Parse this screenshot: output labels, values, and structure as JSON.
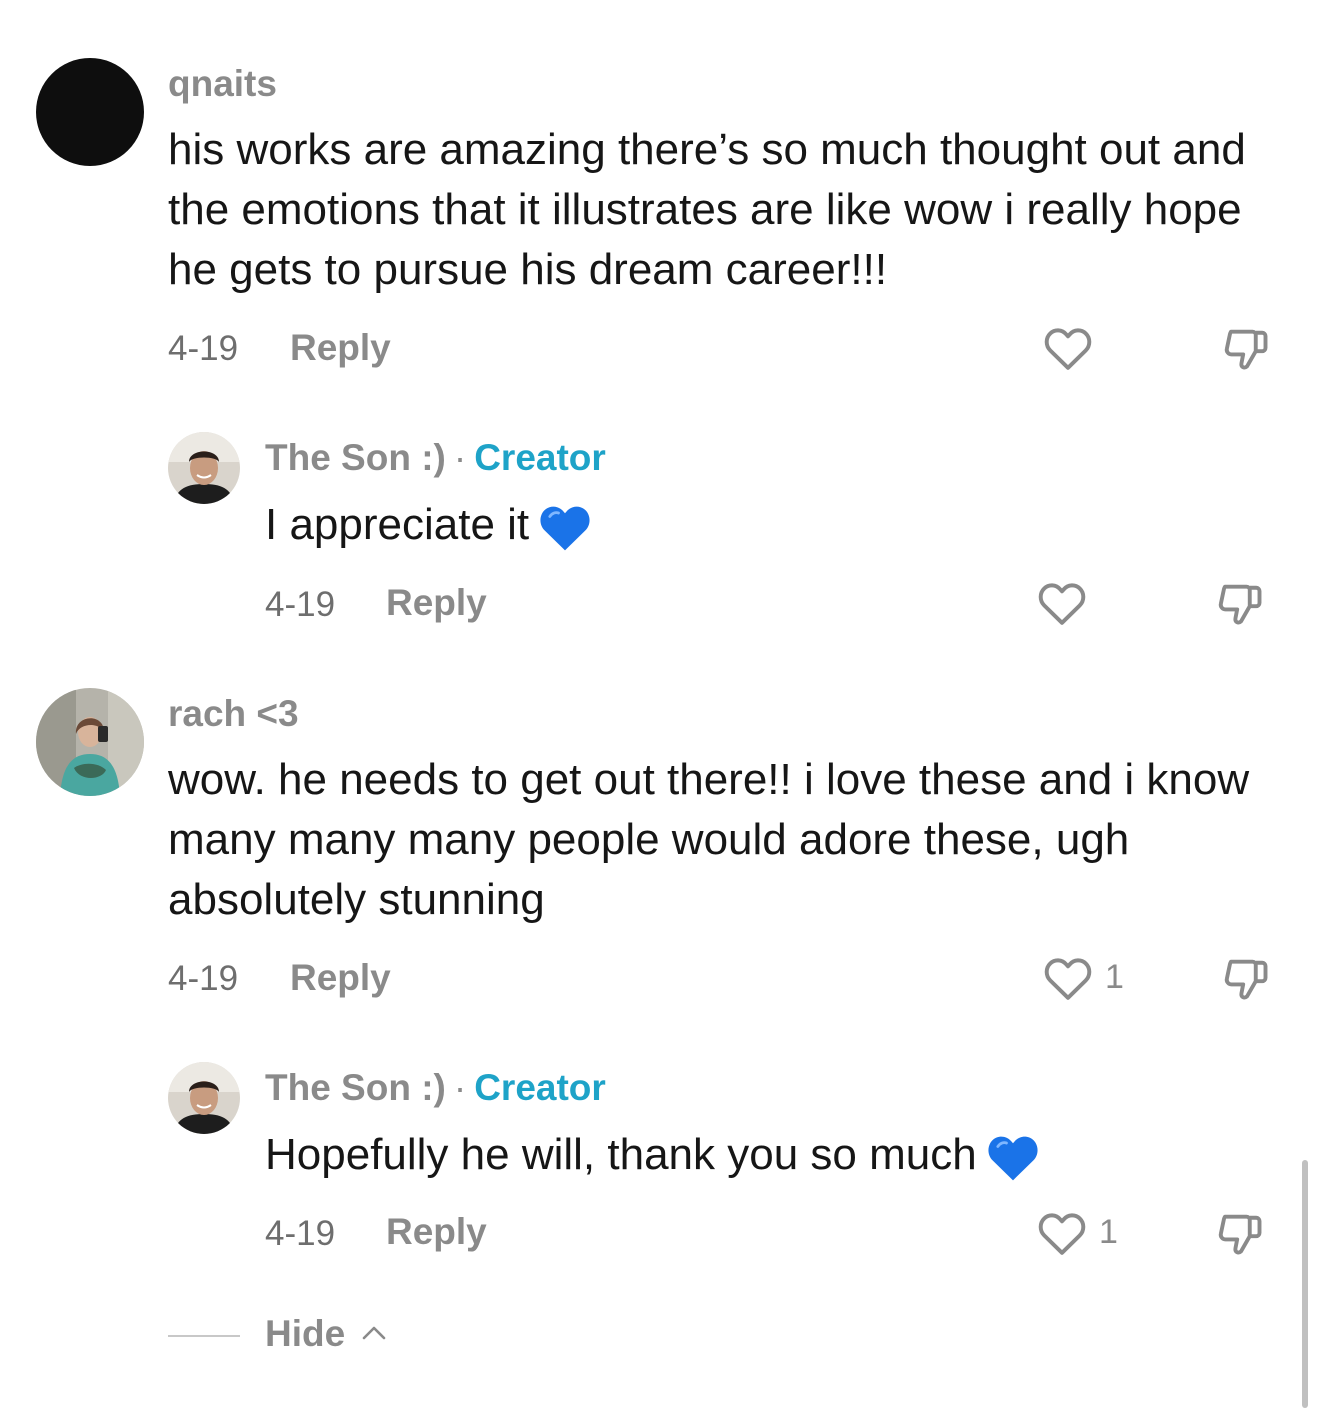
{
  "comments": [
    {
      "username": "qnaits",
      "text": "his works are amazing there’s so much thought out and the emotions that it illustrates are like wow i really hope he gets to pursue his dream career!!!",
      "date": "4-19",
      "reply_label": "Reply",
      "like_count": ""
    },
    {
      "username": "The Son :)",
      "separator": "·",
      "badge": "Creator",
      "text": "I appreciate it",
      "date": "4-19",
      "reply_label": "Reply",
      "like_count": ""
    },
    {
      "username": "rach <3",
      "text": "wow. he needs to get out there!! i love these and i know many many many people would adore these, ugh absolutely stunning",
      "date": "4-19",
      "reply_label": "Reply",
      "like_count": "1"
    },
    {
      "username": "The Son :)",
      "separator": "·",
      "badge": "Creator",
      "text": "Hopefully he will, thank you so much",
      "date": "4-19",
      "reply_label": "Reply",
      "like_count": "1"
    }
  ],
  "hide_label": "Hide",
  "colors": {
    "creator_badge": "#1ea3c8",
    "text": "#161616",
    "muted": "#8a8a8a",
    "heart_emoji": "#1a73e8"
  },
  "icons": [
    "heart-outline-icon",
    "thumbs-down-icon",
    "blue-heart-emoji",
    "chevron-up-icon"
  ]
}
